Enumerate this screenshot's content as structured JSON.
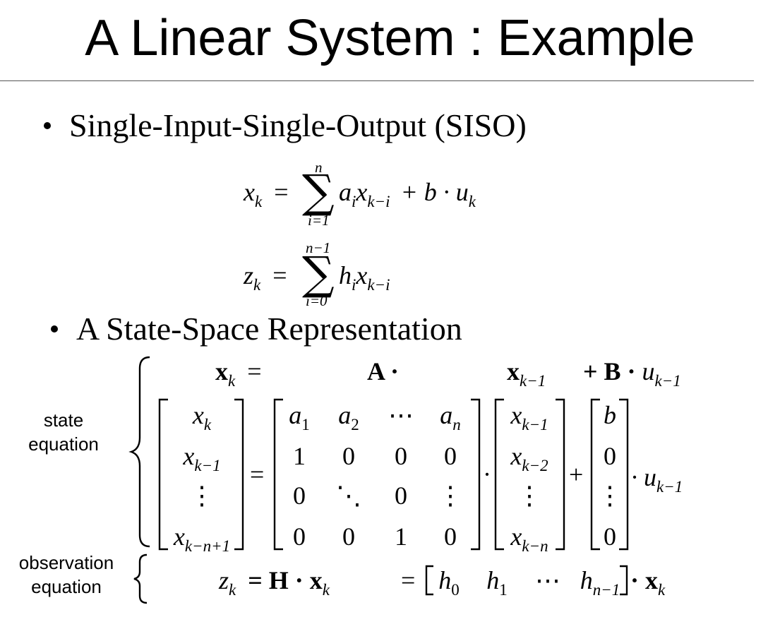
{
  "slide": {
    "title": "A Linear System : Example",
    "bullets": [
      "Single-Input-Single-Output (SISO)",
      "A State-Space Representation"
    ],
    "labels": {
      "state": "state",
      "state_equation": "equation",
      "observation": "observation",
      "observation_equation": "equation"
    },
    "equations": {
      "eq1_lhs": "x",
      "eq1_lhs_sub": "k",
      "eq1_eq": "=",
      "eq1_sum_top": "n",
      "eq1_sum_bottom": "i=1",
      "eq1_a": "a",
      "eq1_a_sub": "i",
      "eq1_x": "x",
      "eq1_x_sub": "k−i",
      "eq1_rest": "+ b · u",
      "eq1_u_sub": "k",
      "eq2_lhs": "z",
      "eq2_lhs_sub": "k",
      "eq2_eq": "=",
      "eq2_sum_top": "n−1",
      "eq2_sum_bottom": "i=0",
      "eq2_h": "h",
      "eq2_h_sub": "i",
      "eq2_x": "x",
      "eq2_x_sub": "k−i"
    },
    "state_space": {
      "compact_xk": "x",
      "compact_xk_sub": "k",
      "compact_eq": "=",
      "compact_A": "A ·",
      "compact_xk1": "x",
      "compact_xk1_sub": "k−1",
      "compact_plusB": "+ B ·",
      "compact_u": "u",
      "compact_u_sub": "k−1",
      "state_vector": [
        [
          "x",
          "k"
        ],
        [
          "x",
          "k−1"
        ],
        [
          "⋮",
          ""
        ],
        [
          "x",
          "k−n+1"
        ]
      ],
      "A_matrix": [
        [
          [
            "a",
            "1"
          ],
          [
            "a",
            "2"
          ],
          [
            "⋯",
            ""
          ],
          [
            "a",
            "n"
          ]
        ],
        [
          [
            "1",
            ""
          ],
          [
            "0",
            ""
          ],
          [
            "0",
            ""
          ],
          [
            "0",
            ""
          ]
        ],
        [
          [
            "0",
            ""
          ],
          [
            "⋱",
            ""
          ],
          [
            "0",
            ""
          ],
          [
            "⋮",
            ""
          ]
        ],
        [
          [
            "0",
            ""
          ],
          [
            "0",
            ""
          ],
          [
            "1",
            ""
          ],
          [
            "0",
            ""
          ]
        ]
      ],
      "prev_state_vector": [
        [
          "x",
          "k−1"
        ],
        [
          "x",
          "k−2"
        ],
        [
          "⋮",
          ""
        ],
        [
          "x",
          "k−n"
        ]
      ],
      "B_vector": [
        [
          "b",
          ""
        ],
        [
          "0",
          ""
        ],
        [
          "⋮",
          ""
        ],
        [
          "0",
          ""
        ]
      ],
      "eq_sign": "=",
      "dot": "·",
      "plus": "+",
      "u_tail": "· u",
      "u_tail_sub": "k−1"
    },
    "observation": {
      "z": "z",
      "z_sub": "k",
      "mid": "= H · x",
      "mid_sub": "k",
      "eq2": "=",
      "h_row": [
        [
          "h",
          "0"
        ],
        [
          "h",
          "1"
        ],
        [
          "⋯",
          ""
        ],
        [
          "h",
          "n−1"
        ]
      ],
      "tail": "· x",
      "tail_sub": "k"
    }
  }
}
